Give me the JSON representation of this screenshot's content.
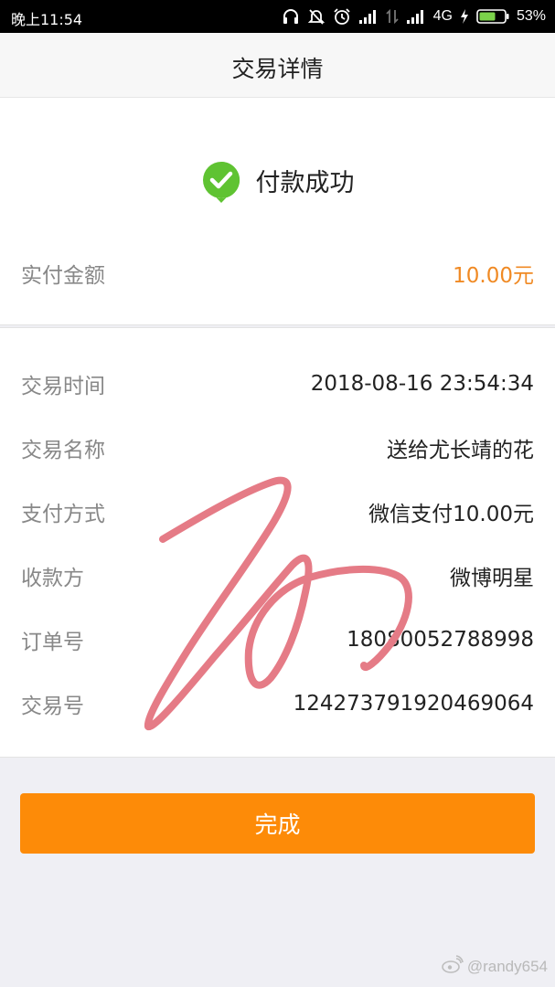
{
  "status_bar": {
    "time": "晚上11:54",
    "network": "4G",
    "battery": "53%"
  },
  "nav": {
    "title": "交易详情"
  },
  "status": {
    "text": "付款成功",
    "color": "#5fc332"
  },
  "amount": {
    "label": "实付金额",
    "value": "10.00元",
    "color": "#f08a24"
  },
  "details": [
    {
      "label": "交易时间",
      "value": "2018-08-16 23:54:34"
    },
    {
      "label": "交易名称",
      "value": "送给尤长靖的花"
    },
    {
      "label": "支付方式",
      "value": "微信支付10.00元"
    },
    {
      "label": "收款方",
      "value": "微博明星"
    },
    {
      "label": "订单号",
      "value": "18080052788998"
    },
    {
      "label": "交易号",
      "value": "124273791920469064"
    }
  ],
  "done_button": {
    "label": "完成",
    "color": "#fd8b08"
  },
  "watermark": {
    "text": "@randy654"
  },
  "signature_color": "#e57b86"
}
